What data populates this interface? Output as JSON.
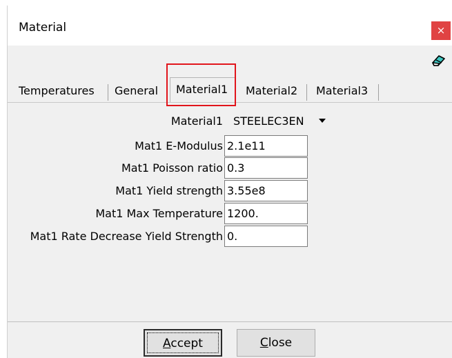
{
  "window": {
    "title": "Material",
    "close_glyph": "×"
  },
  "toolbar": {
    "eraser_icon": "eraser-icon"
  },
  "tabs": [
    {
      "label": "Temperatures"
    },
    {
      "label": "General"
    },
    {
      "label": "Material1",
      "active": true
    },
    {
      "label": "Material2"
    },
    {
      "label": "Material3"
    }
  ],
  "form": {
    "material_label": "Material1",
    "material_value": "STEELEC3EN",
    "rows": [
      {
        "label": "Mat1 E-Modulus",
        "value": "2.1e11"
      },
      {
        "label": "Mat1 Poisson ratio",
        "value": "0.3"
      },
      {
        "label": "Mat1 Yield strength",
        "value": "3.55e8"
      },
      {
        "label": "Mat1 Max Temperature",
        "value": "1200."
      },
      {
        "label": "Mat1 Rate Decrease Yield Strength",
        "value": "0."
      }
    ]
  },
  "buttons": {
    "accept_first": "A",
    "accept_rest": "ccept",
    "close_first": "C",
    "close_rest": "lose"
  },
  "colors": {
    "highlight": "#e1141b",
    "close_button": "#e04343"
  }
}
